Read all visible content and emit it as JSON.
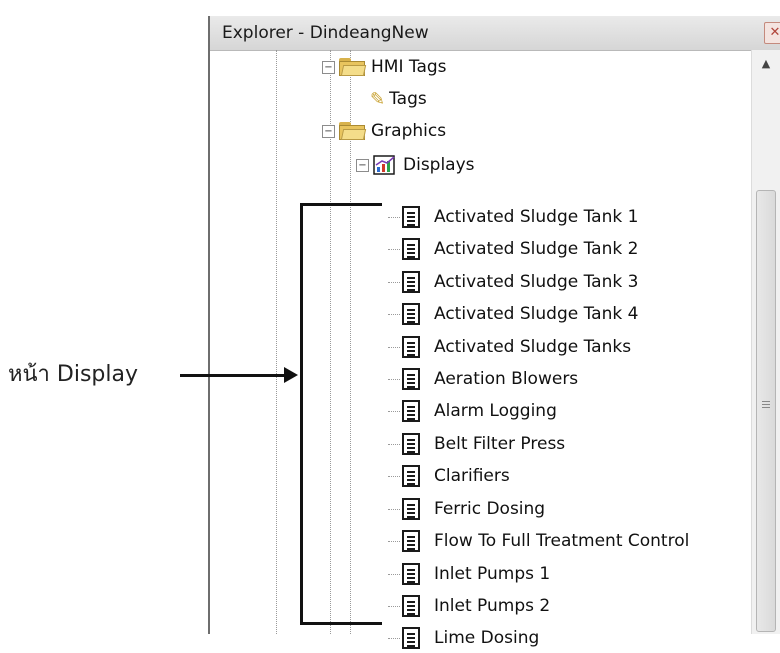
{
  "window": {
    "title": "Explorer - DindeangNew",
    "close_glyph": "✕"
  },
  "tree": {
    "hmi_tags": {
      "label": "HMI Tags",
      "expander": "−"
    },
    "tags": {
      "label": "Tags"
    },
    "graphics": {
      "label": "Graphics",
      "expander": "−"
    },
    "displays": {
      "label": "Displays",
      "expander": "−"
    },
    "display_items": [
      "Activated Sludge Tank 1",
      "Activated Sludge Tank 2",
      "Activated Sludge Tank 3",
      "Activated Sludge Tank 4",
      "Activated Sludge Tanks",
      "Aeration Blowers",
      "Alarm Logging",
      "Belt Filter Press",
      "Clarifiers",
      "Ferric Dosing",
      "Flow To Full Treatment Control",
      "Inlet Pumps 1",
      "Inlet Pumps 2",
      "Lime Dosing"
    ]
  },
  "scrollbar": {
    "up_glyph": "▲"
  },
  "annotation": {
    "label": "หน้า Display"
  },
  "icons": {
    "folder": "folder-icon",
    "document": "display-document-icon",
    "tags": "tag-icon",
    "displays": "displays-chart-icon"
  }
}
